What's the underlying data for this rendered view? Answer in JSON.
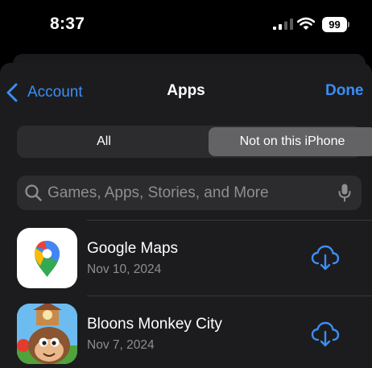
{
  "status_bar": {
    "time": "8:37",
    "battery": "99",
    "icons": [
      "signal-icon",
      "wifi-icon",
      "battery-icon"
    ]
  },
  "nav": {
    "back_label": "Account",
    "title": "Apps",
    "done_label": "Done"
  },
  "segments": {
    "items": [
      "All",
      "Not on this iPhone"
    ],
    "selected": "Not on this iPhone"
  },
  "search": {
    "placeholder": "Games, Apps, Stories, and More",
    "value": ""
  },
  "apps": [
    {
      "name": "Google Maps",
      "date": "Nov 10, 2024",
      "icon": "google-maps-app-icon"
    },
    {
      "name": "Bloons Monkey City",
      "date": "Nov 7, 2024",
      "icon": "bloons-monkey-city-app-icon"
    }
  ],
  "colors": {
    "accent": "#3a8ef6",
    "sheet": "#1c1c1e",
    "control": "#2c2c2e",
    "selected_segment": "#636366",
    "secondary_text": "#8e8e93"
  }
}
